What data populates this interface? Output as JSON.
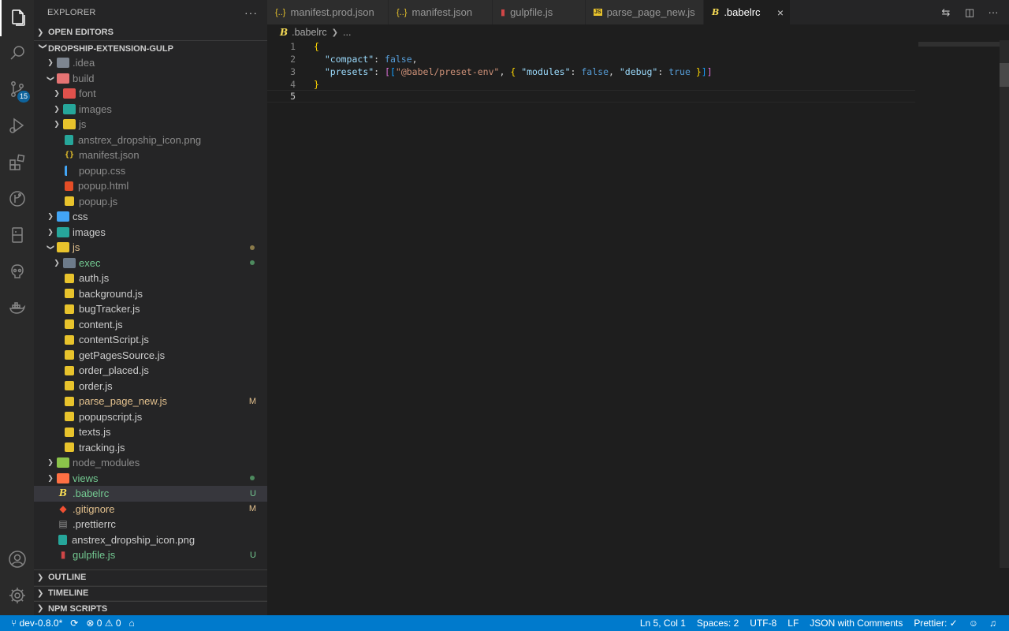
{
  "sidebar": {
    "title": "EXPLORER",
    "more": "···",
    "open_editors": "OPEN EDITORS",
    "project": "DROPSHIP-EXTENSION-GULP",
    "outline": "OUTLINE",
    "timeline": "TIMELINE",
    "npm_scripts": "NPM SCRIPTS",
    "tree": [
      {
        "label": ".idea",
        "depth": 1,
        "kind": "folder",
        "icon": "folder-icon",
        "chevron": "right",
        "style": "ignored"
      },
      {
        "label": "build",
        "depth": 1,
        "kind": "folder",
        "icon": "folder-build-icon",
        "chevron": "down",
        "style": "ignored"
      },
      {
        "label": "font",
        "depth": 2,
        "kind": "folder",
        "icon": "folder-font-icon",
        "chevron": "right",
        "style": "ignored"
      },
      {
        "label": "images",
        "depth": 2,
        "kind": "folder",
        "icon": "folder-images-icon",
        "chevron": "right",
        "style": "ignored"
      },
      {
        "label": "js",
        "depth": 2,
        "kind": "folder",
        "icon": "folder-js-icon",
        "chevron": "right",
        "style": "ignored"
      },
      {
        "label": "anstrex_dropship_icon.png",
        "depth": 2,
        "kind": "file",
        "icon": "png-file-icon",
        "style": "ignored"
      },
      {
        "label": "manifest.json",
        "depth": 2,
        "kind": "file",
        "icon": "json-file-icon",
        "style": "ignored"
      },
      {
        "label": "popup.css",
        "depth": 2,
        "kind": "file",
        "icon": "css-file-icon",
        "style": "ignored"
      },
      {
        "label": "popup.html",
        "depth": 2,
        "kind": "file",
        "icon": "html-file-icon",
        "style": "ignored"
      },
      {
        "label": "popup.js",
        "depth": 2,
        "kind": "file",
        "icon": "js-file-icon",
        "style": "ignored"
      },
      {
        "label": "css",
        "depth": 1,
        "kind": "folder",
        "icon": "folder-css-icon",
        "chevron": "right",
        "style": "normal"
      },
      {
        "label": "images",
        "depth": 1,
        "kind": "folder",
        "icon": "folder-images-icon",
        "chevron": "right",
        "style": "normal"
      },
      {
        "label": "js",
        "depth": 1,
        "kind": "folder",
        "icon": "folder-js-icon",
        "chevron": "down",
        "style": "git-m",
        "dot": "#8a7a4a"
      },
      {
        "label": "exec",
        "depth": 2,
        "kind": "folder",
        "icon": "folder-exec-icon",
        "chevron": "right",
        "style": "git-u",
        "dot": "#4d8a5e"
      },
      {
        "label": "auth.js",
        "depth": 2,
        "kind": "file",
        "icon": "js-file-icon",
        "style": "normal"
      },
      {
        "label": "background.js",
        "depth": 2,
        "kind": "file",
        "icon": "js-file-icon",
        "style": "normal"
      },
      {
        "label": "bugTracker.js",
        "depth": 2,
        "kind": "file",
        "icon": "js-file-icon",
        "style": "normal"
      },
      {
        "label": "content.js",
        "depth": 2,
        "kind": "file",
        "icon": "js-file-icon",
        "style": "normal"
      },
      {
        "label": "contentScript.js",
        "depth": 2,
        "kind": "file",
        "icon": "js-file-icon",
        "style": "normal"
      },
      {
        "label": "getPagesSource.js",
        "depth": 2,
        "kind": "file",
        "icon": "js-file-icon",
        "style": "normal"
      },
      {
        "label": "order_placed.js",
        "depth": 2,
        "kind": "file",
        "icon": "js-file-icon",
        "style": "normal"
      },
      {
        "label": "order.js",
        "depth": 2,
        "kind": "file",
        "icon": "js-file-icon",
        "style": "normal"
      },
      {
        "label": "parse_page_new.js",
        "depth": 2,
        "kind": "file",
        "icon": "js-file-icon",
        "style": "git-m",
        "status": "M"
      },
      {
        "label": "popupscript.js",
        "depth": 2,
        "kind": "file",
        "icon": "js-file-icon",
        "style": "normal"
      },
      {
        "label": "texts.js",
        "depth": 2,
        "kind": "file",
        "icon": "js-file-icon",
        "style": "normal"
      },
      {
        "label": "tracking.js",
        "depth": 2,
        "kind": "file",
        "icon": "js-file-icon",
        "style": "normal"
      },
      {
        "label": "node_modules",
        "depth": 1,
        "kind": "folder",
        "icon": "folder-node-icon",
        "chevron": "right",
        "style": "ignored"
      },
      {
        "label": "views",
        "depth": 1,
        "kind": "folder",
        "icon": "folder-views-icon",
        "chevron": "right",
        "style": "git-u",
        "dot": "#4d8a5e"
      },
      {
        "label": ".babelrc",
        "depth": 1,
        "kind": "file",
        "icon": "babel-file-icon",
        "style": "git-u",
        "status": "U",
        "selected": true
      },
      {
        "label": ".gitignore",
        "depth": 1,
        "kind": "file",
        "icon": "git-file-icon",
        "style": "git-m",
        "status": "M"
      },
      {
        "label": ".prettierrc",
        "depth": 1,
        "kind": "file",
        "icon": "prettier-file-icon",
        "style": "normal"
      },
      {
        "label": "anstrex_dropship_icon.png",
        "depth": 1,
        "kind": "file",
        "icon": "png-file-icon",
        "style": "normal"
      },
      {
        "label": "gulpfile.js",
        "depth": 1,
        "kind": "file",
        "icon": "gulp-file-icon",
        "style": "git-u",
        "status": "U"
      }
    ]
  },
  "activity": {
    "scm_badge": "15"
  },
  "tabs": [
    {
      "label": "manifest.prod.json",
      "icon": "{..}",
      "active": false
    },
    {
      "label": "manifest.json",
      "icon": "{..}",
      "active": false
    },
    {
      "label": "gulpfile.js",
      "icon": "▮",
      "active": false
    },
    {
      "label": "parse_page_new.js",
      "icon": "JS",
      "active": false
    },
    {
      "label": ".babelrc",
      "icon": "B",
      "active": true
    }
  ],
  "tab_close": "×",
  "breadcrumb": {
    "file": ".babelrc",
    "rest": "..."
  },
  "editor": {
    "line_numbers": [
      "1",
      "2",
      "3",
      "4",
      "5"
    ],
    "current_line": 5
  },
  "statusbar": {
    "branch": "dev-0.8.0*",
    "errors": "0",
    "warnings": "0",
    "position": "Ln 5, Col 1",
    "spaces": "Spaces: 2",
    "encoding": "UTF-8",
    "eol": "LF",
    "language": "JSON with Comments",
    "prettier": "Prettier: ✓"
  },
  "colors": {
    "accent": "#007acc",
    "git_modified": "#e2c08d",
    "git_untracked": "#73c991"
  }
}
